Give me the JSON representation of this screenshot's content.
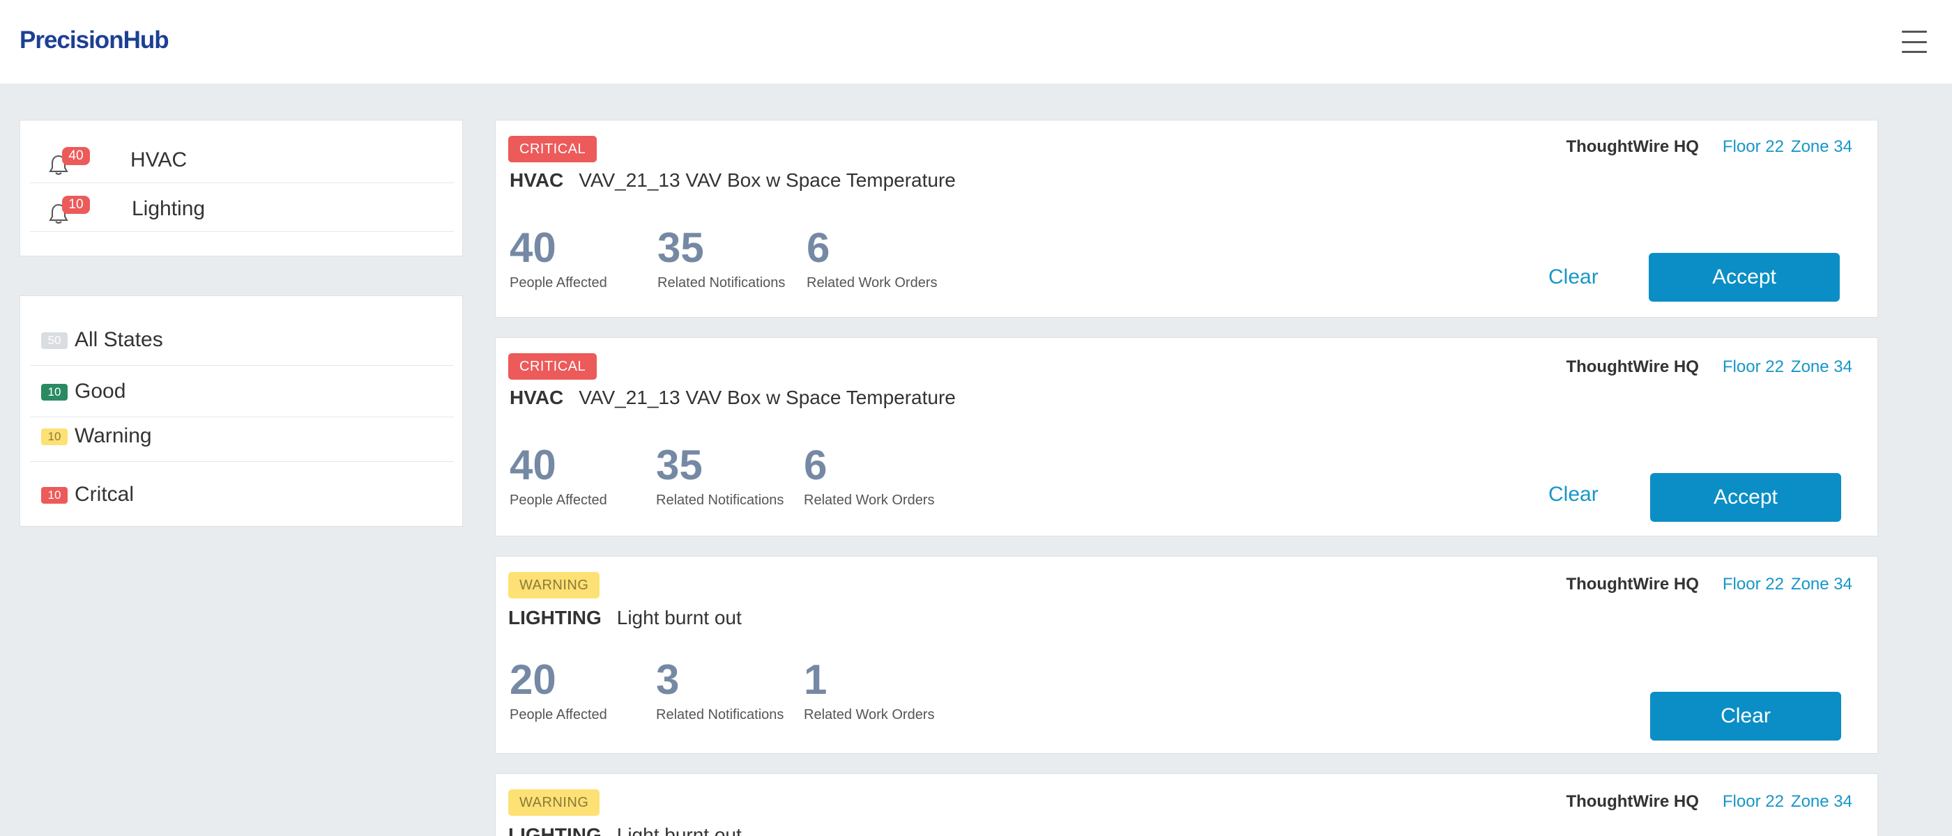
{
  "app": {
    "name": "PrecisionHub"
  },
  "categories": [
    {
      "label": "HVAC",
      "count": "40"
    },
    {
      "label": "Lighting",
      "count": "10"
    }
  ],
  "states": [
    {
      "label": "All States",
      "count": "50",
      "color": "#d9dde2"
    },
    {
      "label": "Good",
      "count": "10",
      "color": "#2b8a62"
    },
    {
      "label": "Warning",
      "count": "10",
      "color": "#fde174"
    },
    {
      "label": "Critcal",
      "count": "10",
      "color": "#ed5a5a"
    }
  ],
  "metric_labels": {
    "people": "People Affected",
    "notifications": "Related Notifications",
    "work_orders": "Related Work Orders"
  },
  "actions": {
    "clear": "Clear",
    "accept": "Accept"
  },
  "notifications": [
    {
      "severity": "CRITICAL",
      "type": "HVAC",
      "description": "VAV_21_13 VAV Box w Space Temperature",
      "building": "ThoughtWire HQ",
      "floor": "Floor 22",
      "zone": "Zone 34",
      "people": "40",
      "related_notifications": "35",
      "work_orders": "6"
    },
    {
      "severity": "CRITICAL",
      "type": "HVAC",
      "description": "VAV_21_13 VAV Box w Space Temperature",
      "building": "ThoughtWire HQ",
      "floor": "Floor 22",
      "zone": "Zone 34",
      "people": "40",
      "related_notifications": "35",
      "work_orders": "6"
    },
    {
      "severity": "WARNING",
      "type": "LIGHTING",
      "description": "Light burnt out",
      "building": "ThoughtWire HQ",
      "floor": "Floor 22",
      "zone": "Zone 34",
      "people": "20",
      "related_notifications": "3",
      "work_orders": "1"
    },
    {
      "severity": "WARNING",
      "type": "LIGHTING",
      "description": "Light burnt out",
      "building": "ThoughtWire HQ",
      "floor": "Floor 22",
      "zone": "Zone 34"
    }
  ],
  "colors": {
    "brand": "#1d3f94",
    "accent": "#0b8ec5",
    "link": "#1896c8",
    "critical": "#ed5a5a",
    "warning": "#fde174",
    "good": "#2b8a62",
    "metric": "#7589a4"
  }
}
